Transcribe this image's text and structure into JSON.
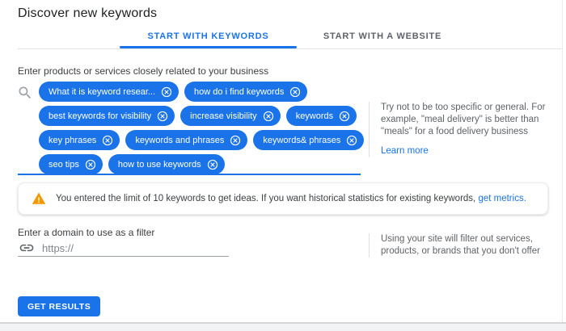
{
  "page": {
    "title": "Discover new keywords"
  },
  "tabs": [
    {
      "label": "START WITH KEYWORDS",
      "active": true
    },
    {
      "label": "START WITH A WEBSITE",
      "active": false
    }
  ],
  "keywords_section": {
    "label": "Enter products or services closely related to your business",
    "chip_rows": [
      [
        "What it is keyword resear...",
        "how do i find keywords"
      ],
      [
        "best keywords for visibility",
        "increase visibility",
        "keywords"
      ],
      [
        "key phrases",
        "keywords and phrases",
        "keywords& phrases"
      ],
      [
        "seo tips",
        "how to use keywords"
      ]
    ],
    "hint": "Try not to be too specific or general. For example, \"meal delivery\" is better than \"meals\" for a food delivery business",
    "learn_more_label": "Learn more"
  },
  "warning": {
    "text": "You entered the limit of 10 keywords to get ideas. If you want historical statistics for existing keywords,",
    "link_label": "get metrics."
  },
  "domain_section": {
    "label": "Enter a domain to use as a filter",
    "placeholder": "https://",
    "hint": "Using your site will filter out services, products, or brands that you don't offer"
  },
  "actions": {
    "get_results_label": "GET RESULTS"
  },
  "colors": {
    "accent": "#1a73e8",
    "warning_icon": "#f29900",
    "chip_background": "#1a73e8"
  },
  "icons": {
    "search": "search-icon",
    "chip_remove": "remove-keyword-icon",
    "warning": "warning-triangle-icon",
    "domain": "link-icon"
  }
}
